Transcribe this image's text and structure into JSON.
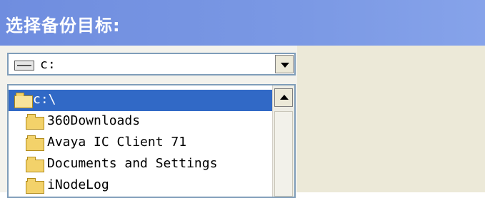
{
  "header": {
    "title": "选择备份目标:"
  },
  "drive_select": {
    "value": "c:",
    "icon": "drive-icon"
  },
  "folder_tree": {
    "items": [
      {
        "label": "c:\\",
        "selected": true,
        "icon": "open-folder-icon"
      },
      {
        "label": "360Downloads",
        "selected": false,
        "icon": "folder-icon"
      },
      {
        "label": "Avaya IC Client 71",
        "selected": false,
        "icon": "folder-icon"
      },
      {
        "label": "Documents and Settings",
        "selected": false,
        "icon": "folder-icon"
      },
      {
        "label": "iNodeLog",
        "selected": false,
        "icon": "folder-icon"
      }
    ]
  },
  "colors": {
    "header_bg": "#7a98e4",
    "selection_bg": "#3169c6",
    "panel_bg": "#ece9d8"
  }
}
